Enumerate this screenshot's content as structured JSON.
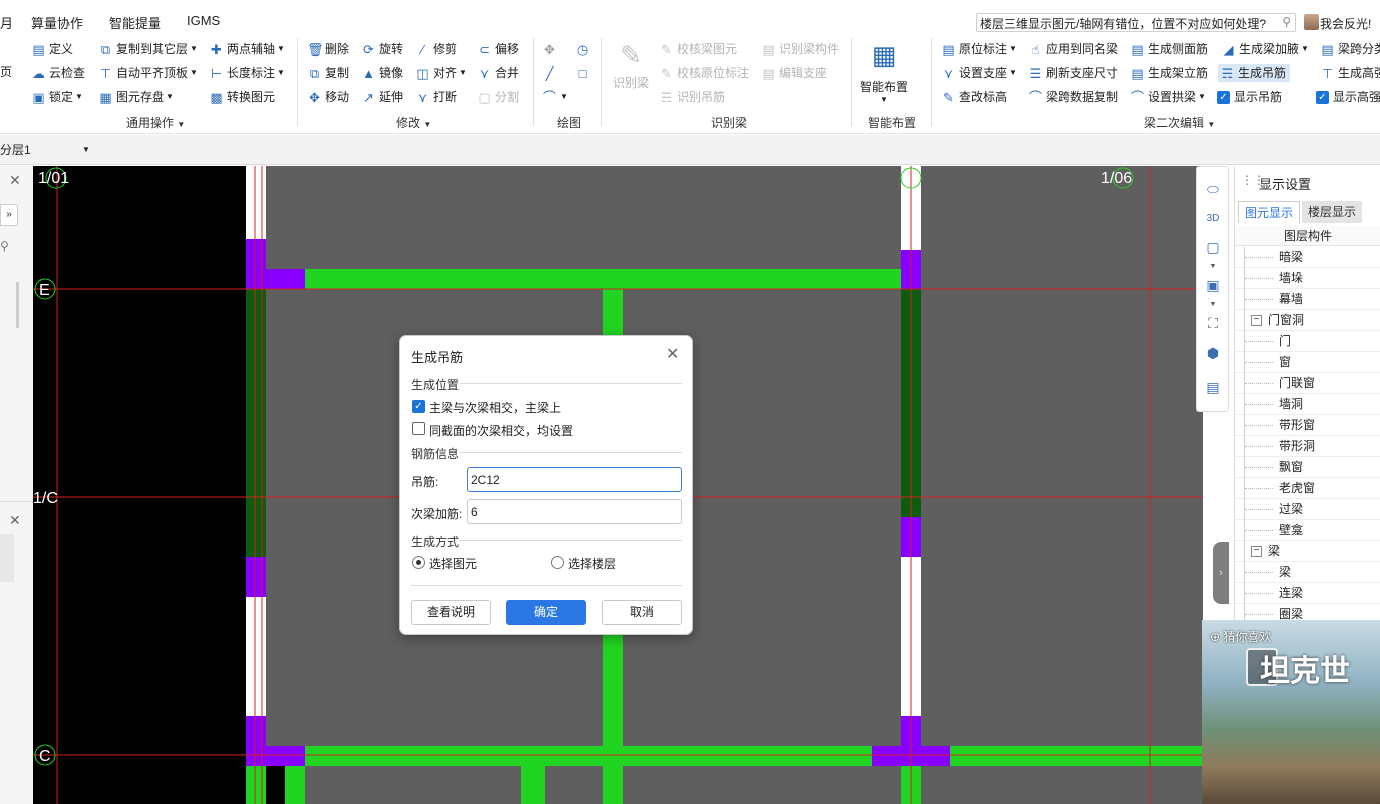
{
  "menu": {
    "items": [
      "月",
      "算量协作",
      "智能提量",
      "IGMS"
    ]
  },
  "search": {
    "value": "楼层三维显示图元/轴网有错位，位置不对应如何处理?"
  },
  "feedback": {
    "label": "我会反光!"
  },
  "ribbon": {
    "general": {
      "label": "通用操作",
      "items": [
        "定义",
        "云检查",
        "锁定",
        "复制到其它层",
        "自动平齐顶板",
        "图元存盘",
        "两点辅轴",
        "长度标注",
        "转换图元"
      ],
      "edge": "页"
    },
    "modify": {
      "label": "修改",
      "items": [
        "删除",
        "旋转",
        "修剪",
        "偏移",
        "复制",
        "镜像",
        "对齐",
        "合并",
        "移动",
        "延伸",
        "打断",
        "分割"
      ]
    },
    "draw": {
      "label": "绘图"
    },
    "recognize": {
      "label": "识别梁",
      "big": "识别梁",
      "items": [
        "校核梁图元",
        "识别梁构件",
        "校核原位标注",
        "编辑支座",
        "识别吊筋"
      ]
    },
    "smart": {
      "label": "智能布置",
      "big": "智能布置"
    },
    "secondary": {
      "label": "梁二次编辑",
      "items": [
        "原位标注",
        "应用到同名梁",
        "生成侧面筋",
        "生成梁加腋",
        "梁跨分类",
        "设置支座",
        "刷新支座尺寸",
        "生成架立筋",
        "生成吊筋",
        "生成高强",
        "查改标高",
        "梁跨数据复制",
        "设置拱梁",
        "显示吊筋",
        "显示高强"
      ]
    }
  },
  "toolbar2": {
    "layer": "分层1"
  },
  "canvas": {
    "axes": [
      "1/01",
      "1/06",
      "E",
      "1/C",
      "C"
    ]
  },
  "display_settings": {
    "title": "显示设置",
    "tabs": [
      "图元显示",
      "楼层显示"
    ],
    "header": "图层构件",
    "rows": [
      {
        "label": "暗梁",
        "parent": false
      },
      {
        "label": "墙垛",
        "parent": false
      },
      {
        "label": "幕墙",
        "parent": false
      },
      {
        "label": "门窗洞",
        "parent": true
      },
      {
        "label": "门",
        "parent": false
      },
      {
        "label": "窗",
        "parent": false
      },
      {
        "label": "门联窗",
        "parent": false
      },
      {
        "label": "墙洞",
        "parent": false
      },
      {
        "label": "带形窗",
        "parent": false
      },
      {
        "label": "带形洞",
        "parent": false
      },
      {
        "label": "飘窗",
        "parent": false
      },
      {
        "label": "老虎窗",
        "parent": false
      },
      {
        "label": "过梁",
        "parent": false
      },
      {
        "label": "壁龛",
        "parent": false
      },
      {
        "label": "梁",
        "parent": true
      },
      {
        "label": "梁",
        "parent": false
      },
      {
        "label": "连梁",
        "parent": false
      },
      {
        "label": "圈梁",
        "parent": false
      }
    ]
  },
  "ad": {
    "label": "猜你喜欢",
    "title": "坦克世"
  },
  "dialog": {
    "title": "生成吊筋",
    "sections": {
      "position": "生成位置",
      "rebar": "钢筋信息",
      "method": "生成方式"
    },
    "options": {
      "main_secondary": "主梁与次梁相交，主梁上",
      "same_section": "同截面的次梁相交，均设置"
    },
    "fields": {
      "hanger_label": "吊筋:",
      "hanger_value": "2C12",
      "secondary_label": "次梁加筋:",
      "secondary_value": "6"
    },
    "radios": {
      "select_element": "选择图元",
      "select_floor": "选择楼层"
    },
    "buttons": {
      "help": "查看说明",
      "ok": "确定",
      "cancel": "取消"
    }
  },
  "colors": {
    "beam": "#22d422",
    "column": "#8800ff",
    "axis": "#d42020",
    "canvas": "#5f5f5f",
    "accent": "#2b78e4"
  }
}
